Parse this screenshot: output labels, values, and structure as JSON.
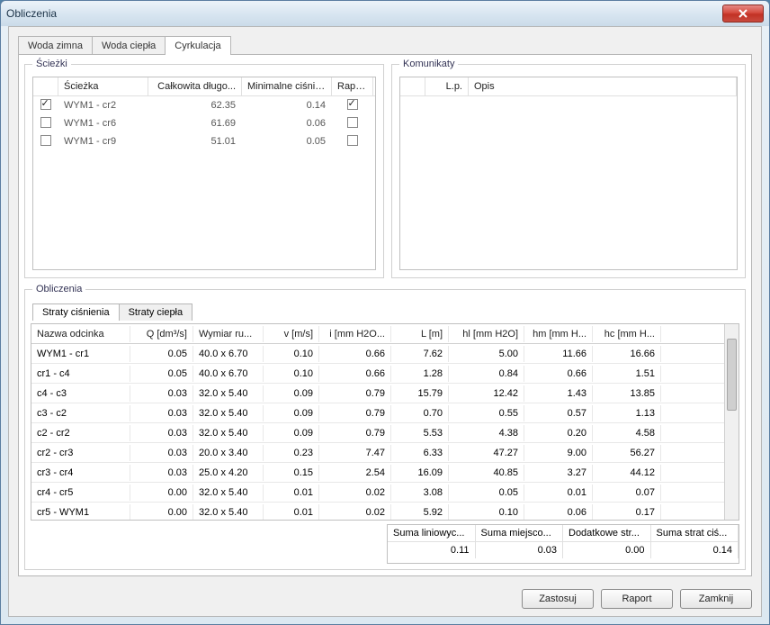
{
  "window": {
    "title": "Obliczenia"
  },
  "main_tabs": [
    {
      "label": "Woda zimna",
      "active": false
    },
    {
      "label": "Woda ciepła",
      "active": false
    },
    {
      "label": "Cyrkulacja",
      "active": true
    }
  ],
  "paths_group": {
    "legend": "Ścieżki"
  },
  "messages_group": {
    "legend": "Komunikaty"
  },
  "calc_group": {
    "legend": "Obliczenia"
  },
  "paths_headers": {
    "chk": "",
    "path": "Ścieżka",
    "totlen": "Całkowita długo...",
    "minp": "Minimalne ciśnie...",
    "raport": "Raport"
  },
  "paths_rows": [
    {
      "checked": true,
      "name": "WYM1 - cr2",
      "totlen": "62.35",
      "minp": "0.14",
      "raport": true
    },
    {
      "checked": false,
      "name": "WYM1 - cr6",
      "totlen": "61.69",
      "minp": "0.06",
      "raport": false
    },
    {
      "checked": false,
      "name": "WYM1 - cr9",
      "totlen": "51.01",
      "minp": "0.05",
      "raport": false
    }
  ],
  "messages_headers": {
    "lp": "L.p.",
    "opis": "Opis"
  },
  "inner_tabs": [
    {
      "label": "Straty ciśnienia",
      "active": true
    },
    {
      "label": "Straty ciepła",
      "active": false
    }
  ],
  "calc_headers": {
    "name": "Nazwa odcinka",
    "q": "Q [dm³/s]",
    "dim": "Wymiar ru...",
    "v": "v [m/s]",
    "i": "i [mm H2O...",
    "L": "L [m]",
    "hl": "hl [mm H2O]",
    "hm": "hm [mm H...",
    "hc": "hc [mm H..."
  },
  "calc_rows": [
    {
      "name": "WYM1 - cr1",
      "q": "0.05",
      "dim": "40.0 x 6.70",
      "v": "0.10",
      "i": "0.66",
      "L": "7.62",
      "hl": "5.00",
      "hm": "11.66",
      "hc": "16.66"
    },
    {
      "name": "cr1 - c4",
      "q": "0.05",
      "dim": "40.0 x 6.70",
      "v": "0.10",
      "i": "0.66",
      "L": "1.28",
      "hl": "0.84",
      "hm": "0.66",
      "hc": "1.51"
    },
    {
      "name": "c4 - c3",
      "q": "0.03",
      "dim": "32.0 x 5.40",
      "v": "0.09",
      "i": "0.79",
      "L": "15.79",
      "hl": "12.42",
      "hm": "1.43",
      "hc": "13.85"
    },
    {
      "name": "c3 - c2",
      "q": "0.03",
      "dim": "32.0 x 5.40",
      "v": "0.09",
      "i": "0.79",
      "L": "0.70",
      "hl": "0.55",
      "hm": "0.57",
      "hc": "1.13"
    },
    {
      "name": "c2 - cr2",
      "q": "0.03",
      "dim": "32.0 x 5.40",
      "v": "0.09",
      "i": "0.79",
      "L": "5.53",
      "hl": "4.38",
      "hm": "0.20",
      "hc": "4.58"
    },
    {
      "name": "cr2 - cr3",
      "q": "0.03",
      "dim": "20.0 x 3.40",
      "v": "0.23",
      "i": "7.47",
      "L": "6.33",
      "hl": "47.27",
      "hm": "9.00",
      "hc": "56.27"
    },
    {
      "name": "cr3 - cr4",
      "q": "0.03",
      "dim": "25.0 x 4.20",
      "v": "0.15",
      "i": "2.54",
      "L": "16.09",
      "hl": "40.85",
      "hm": "3.27",
      "hc": "44.12"
    },
    {
      "name": "cr4 - cr5",
      "q": "0.00",
      "dim": "32.0 x 5.40",
      "v": "0.01",
      "i": "0.02",
      "L": "3.08",
      "hl": "0.05",
      "hm": "0.01",
      "hc": "0.07"
    },
    {
      "name": "cr5 - WYM1",
      "q": "0.00",
      "dim": "32.0 x 5.40",
      "v": "0.01",
      "i": "0.02",
      "L": "5.92",
      "hl": "0.10",
      "hm": "0.06",
      "hc": "0.17"
    }
  ],
  "summary_headers": {
    "s1": "Suma liniowyc...",
    "s2": "Suma miejsco...",
    "s3": "Dodatkowe str...",
    "s4": "Suma strat ciś..."
  },
  "summary_values": {
    "s1": "0.11",
    "s2": "0.03",
    "s3": "0.00",
    "s4": "0.14"
  },
  "buttons": {
    "apply": "Zastosuj",
    "raport": "Raport",
    "close": "Zamknij"
  }
}
